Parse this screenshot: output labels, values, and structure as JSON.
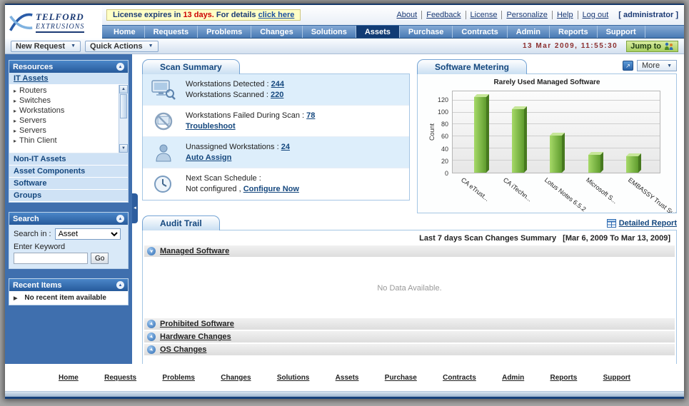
{
  "header": {
    "logo": {
      "line1": "TELFORD",
      "line2": "EXTRUSIONS"
    },
    "license": {
      "prefix": "License expires in ",
      "days": "13 days.",
      "middle": " For details ",
      "link": "click here"
    },
    "links": [
      "About",
      "Feedback",
      "License",
      "Personalize",
      "Help",
      "Log out"
    ],
    "user": "[ administrator ]"
  },
  "nav": {
    "tabs": [
      "Home",
      "Requests",
      "Problems",
      "Changes",
      "Solutions",
      "Assets",
      "Purchase",
      "Contracts",
      "Admin",
      "Reports",
      "Support"
    ],
    "active_tab": "Assets"
  },
  "toolbar": {
    "new_request": "New Request",
    "quick_actions": "Quick Actions",
    "datetime": "13 Mar 2009, 11:55:30",
    "jump_to": "Jump to"
  },
  "sidebar": {
    "resources": {
      "title": "Resources",
      "active_item": "IT Assets",
      "tree": [
        "Routers",
        "Switches",
        "Workstations",
        "Servers",
        "Servers",
        "Thin Client"
      ],
      "sections": [
        "Non-IT Assets",
        "Asset Components",
        "Software",
        "Groups"
      ]
    },
    "search": {
      "title": "Search",
      "search_in_label": "Search in :",
      "search_in_value": "Asset",
      "keyword_label": "Enter Keyword",
      "keyword_value": "",
      "go": "Go"
    },
    "recent": {
      "title": "Recent Items",
      "empty": "No recent item available"
    }
  },
  "scan_summary": {
    "title": "Scan Summary",
    "row1": {
      "label1": "Workstations Detected :",
      "value1": "244",
      "label2": "Workstations Scanned :",
      "value2": "220"
    },
    "row2": {
      "label": "Workstations Failed During Scan :",
      "value": "78",
      "action": "Troubleshoot"
    },
    "row3": {
      "label": "Unassigned Workstations :",
      "value": "24",
      "action": "Auto Assign"
    },
    "row4": {
      "label": "Next Scan Schedule :",
      "status": "Not configured ,",
      "action": "Configure Now"
    }
  },
  "software_metering": {
    "title": "Software Metering",
    "more": "More"
  },
  "chart_data": {
    "type": "bar",
    "title": "Rarely Used Managed Software",
    "xlabel": "",
    "ylabel": "Count",
    "categories": [
      "CA eTrust...",
      "CA iTechn...",
      "Lotus Notes 6.5.2",
      "Microsoft S...",
      "EMBASSY Trust Sui..."
    ],
    "values": [
      125,
      105,
      62,
      30,
      27
    ],
    "ylim": [
      0,
      135
    ],
    "yticks": [
      0,
      20,
      40,
      60,
      80,
      100,
      120
    ],
    "grid": true,
    "legend_position": "none",
    "bar_color": "#76b93f"
  },
  "audit_trail": {
    "title": "Audit Trail",
    "detailed_report": "Detailed Report",
    "summary": "Last 7 days Scan Changes Summary",
    "date_range": "[Mar 6, 2009 To Mar 13, 2009]",
    "no_data": "No Data Available.",
    "sections": [
      "Managed Software",
      "Prohibited Software",
      "Hardware Changes",
      "OS Changes"
    ]
  },
  "footer": {
    "links": [
      "Home",
      "Requests",
      "Problems",
      "Changes",
      "Solutions",
      "Assets",
      "Purchase",
      "Contracts",
      "Admin",
      "Reports",
      "Support"
    ]
  },
  "icons": {
    "tree_caret": "▸",
    "dropdown_arrow": "▼",
    "collapse_left": "◄",
    "panel_toggle": "▲",
    "scrollbar_up": "▲",
    "scrollbar_down": "▼",
    "recent_arrow": "▶",
    "export_arrow": "↗",
    "section_arrow": "➤"
  },
  "colors": {
    "accent_blue": "#14477e",
    "nav_active": "#123c74",
    "panel_header": "#2d63a8",
    "bar_green": "#76b93f",
    "license_warn_red": "#cc0000",
    "jump_green": "#a8cf62"
  }
}
